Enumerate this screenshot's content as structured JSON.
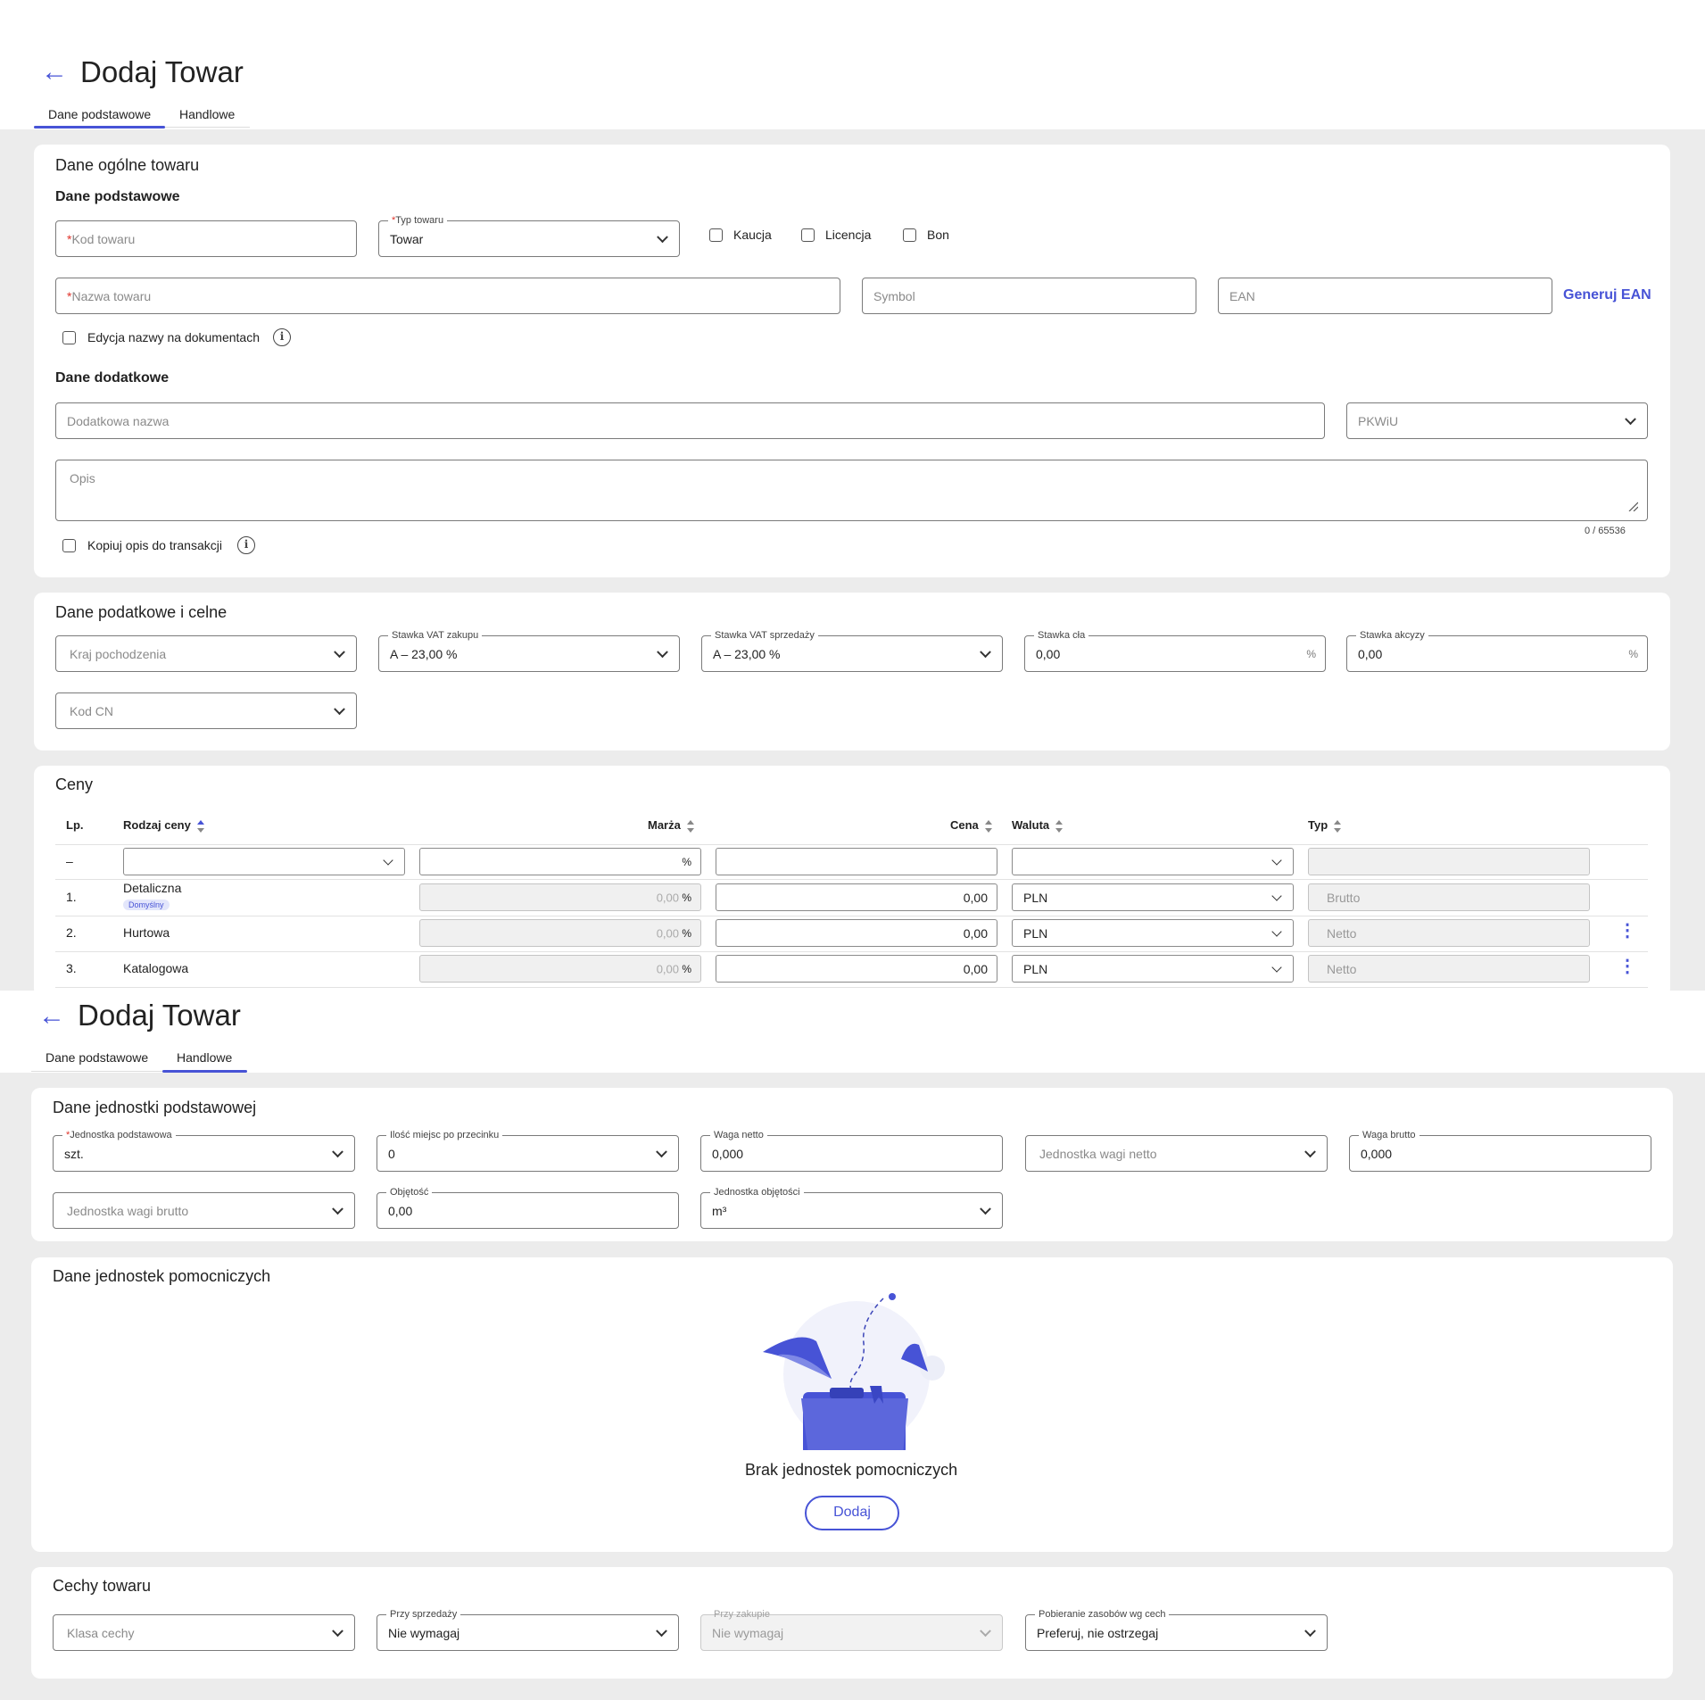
{
  "top": {
    "back_icon": "arrow-left-icon",
    "title": "Dodaj Towar",
    "tabs": [
      "Dane podstawowe",
      "Handlowe"
    ],
    "active_tab": 0,
    "accent": "#4753d6"
  },
  "general": {
    "title": "Dane ogólne towaru",
    "basic_title": "Dane podstawowe",
    "kod_placeholder": "Kod towaru",
    "typ_label": "Typ towaru",
    "typ_value": "Towar",
    "checks": [
      "Kaucja",
      "Licencja",
      "Bon"
    ],
    "nazwa_placeholder": "Nazwa towaru",
    "symbol_placeholder": "Symbol",
    "ean_placeholder": "EAN",
    "generate_ean": "Generuj EAN",
    "edit_name_label": "Edycja nazwy na dokumentach",
    "extra_title": "Dane dodatkowe",
    "extra_name_placeholder": "Dodatkowa nazwa",
    "pkwiu_placeholder": "PKWiU",
    "opis_placeholder": "Opis",
    "opis_counter": "0 / 65536",
    "copy_desc_label": "Kopiuj opis do transakcji"
  },
  "tax": {
    "title": "Dane podatkowe i celne",
    "kraj_placeholder": "Kraj pochodzenia",
    "vat_purchase_label": "Stawka VAT zakupu",
    "vat_purchase_value": "A – 23,00 %",
    "vat_sale_label": "Stawka VAT sprzedaży",
    "vat_sale_value": "A – 23,00 %",
    "duty_label": "Stawka cła",
    "duty_value": "0,00",
    "excise_label": "Stawka akcyzy",
    "excise_value": "0,00",
    "percent": "%",
    "cn_placeholder": "Kod CN"
  },
  "prices": {
    "title": "Ceny",
    "headers": {
      "lp": "Lp.",
      "kind": "Rodzaj ceny",
      "margin": "Marża",
      "price": "Cena",
      "currency": "Waluta",
      "type": "Typ"
    },
    "filter_dash": "–",
    "filter_percent": "%",
    "default_badge": "Domyślny",
    "rows": [
      {
        "lp": "1.",
        "kind": "Detaliczna",
        "margin": "0,00",
        "pct": "%",
        "price": "0,00",
        "currency": "PLN",
        "type": "Brutto"
      },
      {
        "lp": "2.",
        "kind": "Hurtowa",
        "margin": "0,00",
        "pct": "%",
        "price": "0,00",
        "currency": "PLN",
        "type": "Netto"
      },
      {
        "lp": "3.",
        "kind": "Katalogowa",
        "margin": "0,00",
        "pct": "%",
        "price": "0,00",
        "currency": "PLN",
        "type": "Netto"
      }
    ]
  },
  "bottom": {
    "title": "Dodaj Towar",
    "tabs": [
      "Dane podstawowe",
      "Handlowe"
    ],
    "active_tab": 1
  },
  "unit": {
    "title": "Dane jednostki podstawowej",
    "base_label": "Jednostka podstawowa",
    "base_value": "szt.",
    "decimals_label": "Ilość miejsc po przecinku",
    "decimals_value": "0",
    "net_weight_label": "Waga netto",
    "net_weight_value": "0,000",
    "net_weight_unit_placeholder": "Jednostka wagi netto",
    "gross_weight_label": "Waga brutto",
    "gross_weight_value": "0,000",
    "gross_weight_unit_placeholder": "Jednostka wagi brutto",
    "volume_label": "Objętość",
    "volume_value": "0,00",
    "volume_unit_label": "Jednostka objętości",
    "volume_unit_value": "m³"
  },
  "aux": {
    "title": "Dane jednostek pomocniczych",
    "empty_text": "Brak jednostek pomocniczych",
    "add_button": "Dodaj"
  },
  "features": {
    "title": "Cechy towaru",
    "class_placeholder": "Klasa cechy",
    "sale_label": "Przy sprzedaży",
    "sale_value": "Nie wymagaj",
    "purchase_label": "Przy zakupie",
    "purchase_value": "Nie wymagaj",
    "fetch_label": "Pobieranie zasobów wg cech",
    "fetch_value": "Preferuj, nie ostrzegaj"
  }
}
